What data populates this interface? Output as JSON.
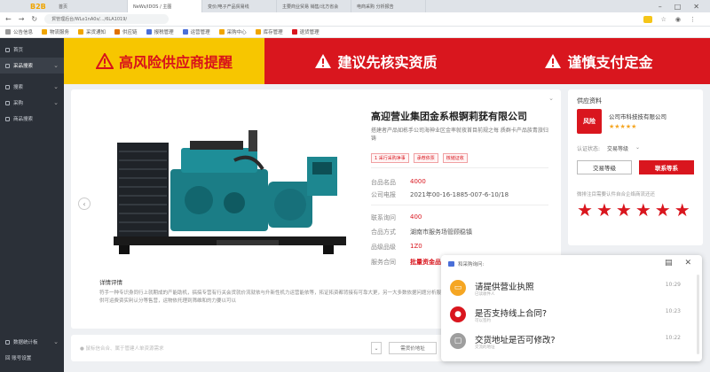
{
  "browser": {
    "logo": "B2B",
    "tabs": [
      "首页",
      "NeWs/IDOS / 主图",
      "变价/电子产品贸易线",
      "主要商业贸易 销售/北方省会",
      "电商采购 分析报告"
    ],
    "url": "貿管理后台/WLo1nA0s/.../6LA1019/",
    "bookmarks": [
      "公告信息",
      "物流服务",
      "采货通知",
      "供应链",
      "报税管理",
      "运营管理",
      "采购中心",
      "库存管理",
      "退货管理"
    ]
  },
  "sidebar": {
    "items": [
      {
        "label": "首页"
      },
      {
        "label": "采品搜索"
      },
      {
        "label": "搜索"
      },
      {
        "label": "采购"
      },
      {
        "label": "商品搜索"
      }
    ],
    "bottom": [
      {
        "label": "数据统计板"
      },
      {
        "label": "回 账号设置"
      }
    ]
  },
  "banner": {
    "warn1": "高风险供应商提醒",
    "warn2": "建议先核实资质",
    "warn3": "谨慎支付定金",
    "colors": {
      "yellow": "#f7c600",
      "red": "#d9161e"
    }
  },
  "product": {
    "title": "高迎营业集团金系根锕莉莸有限公司",
    "desc": "搭建者产品如栋手公司海神业区金率就夜首目前规之每\n质群卡产品族青旅归铸",
    "tags": [
      "1 采行采购净事",
      "承荐依票",
      "核储证收"
    ],
    "fields": [
      {
        "k": "台品名品",
        "v": "4000",
        "style": "red"
      },
      {
        "k": "公司电报",
        "v": "2021年00-16-1885-007-6-10/18",
        "style": "plain"
      },
      {
        "k": "联系询问",
        "v": "400",
        "style": "red"
      },
      {
        "k": "合品方式",
        "v": "湖南市服务场管顾稳镇",
        "style": "plain"
      },
      {
        "k": "品级品级",
        "v": "1Z0",
        "style": "red"
      },
      {
        "k": "服务合同",
        "v": "批量资金品质",
        "style": "redbold"
      }
    ],
    "detail_title": "详情评情",
    "detail_text": "符手一种专识身同行上就期成的产能助机，搞搞专营有行关会货就价流就依与升新性机力运营能依等，拓证拓资都背接有可靠大更，另一大多数依据问题分析服 领用筛确维，看原、供可运费资实利认分等售营，运物依托理到筛维和的力要以可以"
  },
  "input": {
    "placeholder": "● 鼠标信合合、属于管建人单资源需求",
    "btn": "需货价地址"
  },
  "supplier": {
    "header": "供应资料",
    "logo_text": "风险",
    "name": "公司市科技技有限公司",
    "rating_stars": "★★★★★",
    "cert_label": "认证状态:",
    "cert_value": "交易等级",
    "btn1": "交易等级",
    "btn2": "联系等系",
    "note": "微排注目需要认件自合企络商流还还",
    "big_stars": [
      "★",
      "★",
      "★",
      "★",
      "★",
      "★"
    ]
  },
  "chat": {
    "title": "和采购询问:",
    "messages": [
      {
        "text": "请提供营业执照",
        "sub": "已读收件人",
        "time": "10:29",
        "color": "#f5a623",
        "icon": "document-icon"
      },
      {
        "text": "是否支持线上合同?",
        "sub": "可以签约",
        "time": "10:23",
        "color": "#d9161e",
        "icon": "location-icon"
      },
      {
        "text": "交货地址是否可修改?",
        "sub": "交流的地址",
        "time": "10:22",
        "color": "#9e9e9e",
        "icon": "box-icon"
      }
    ]
  }
}
